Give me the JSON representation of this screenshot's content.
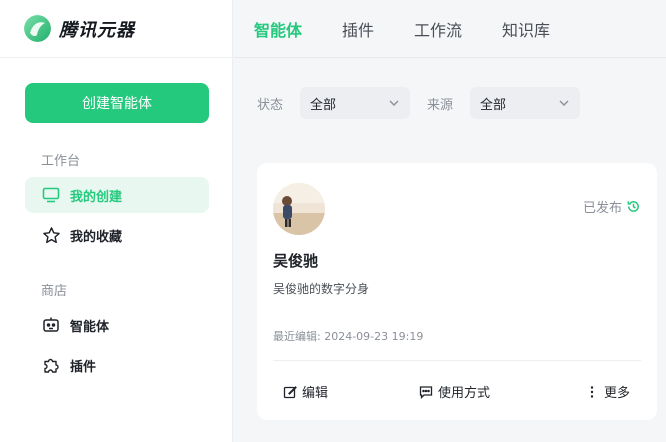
{
  "app": {
    "title": "腾讯元器"
  },
  "sidebar": {
    "create_button": "创建智能体",
    "workspace_label": "工作台",
    "workspace_items": [
      {
        "label": "我的创建",
        "icon": "monitor-icon",
        "active": true
      },
      {
        "label": "我的收藏",
        "icon": "star-icon",
        "active": false
      }
    ],
    "store_label": "商店",
    "store_items": [
      {
        "label": "智能体",
        "icon": "robot-icon"
      },
      {
        "label": "插件",
        "icon": "puzzle-icon"
      }
    ]
  },
  "topbar": {
    "tabs": [
      {
        "label": "智能体",
        "active": true
      },
      {
        "label": "插件",
        "active": false
      },
      {
        "label": "工作流",
        "active": false
      },
      {
        "label": "知识库",
        "active": false
      }
    ]
  },
  "filters": {
    "status_label": "状态",
    "status_value": "全部",
    "source_label": "来源",
    "source_value": "全部"
  },
  "card": {
    "name": "吴俊驰",
    "description": "吴俊驰的数字分身",
    "status": "已发布",
    "last_edited": "最近编辑: 2024-09-23 19:19",
    "actions": {
      "edit": "编辑",
      "usage": "使用方式",
      "more": "更多"
    }
  },
  "colors": {
    "accent": "#25c97e",
    "accent_light": "#e8f8f0",
    "text": "#1f2329",
    "muted": "#8a8f99"
  }
}
